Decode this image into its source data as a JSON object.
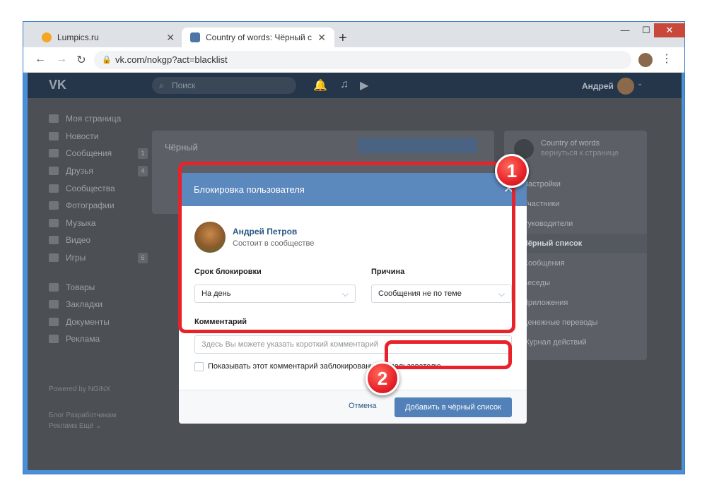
{
  "browser": {
    "tabs": [
      {
        "title": "Lumpics.ru",
        "favicon_color": "#f5a623"
      },
      {
        "title": "Country of words: Чёрный список",
        "favicon_color": "#4a76a8"
      }
    ],
    "address": "vk.com/nokgp?act=blacklist"
  },
  "vk": {
    "logo": "VK",
    "search_placeholder": "Поиск",
    "user_name": "Андрей",
    "left_menu": [
      {
        "label": "Моя страница",
        "icon": "home-icon",
        "badge": ""
      },
      {
        "label": "Новости",
        "icon": "news-icon",
        "badge": ""
      },
      {
        "label": "Сообщения",
        "icon": "chat-icon",
        "badge": "1"
      },
      {
        "label": "Друзья",
        "icon": "friends-icon",
        "badge": "4"
      },
      {
        "label": "Сообщества",
        "icon": "groups-icon",
        "badge": ""
      },
      {
        "label": "Фотографии",
        "icon": "camera-icon",
        "badge": ""
      },
      {
        "label": "Музыка",
        "icon": "music-icon",
        "badge": ""
      },
      {
        "label": "Видео",
        "icon": "video-icon",
        "badge": ""
      },
      {
        "label": "Игры",
        "icon": "gamepad-icon",
        "badge": "6"
      }
    ],
    "left_menu_2": [
      {
        "label": "Товары",
        "icon": "bag-icon"
      },
      {
        "label": "Закладки",
        "icon": "star-icon"
      },
      {
        "label": "Документы",
        "icon": "document-icon"
      },
      {
        "label": "Реклама",
        "icon": "megaphone-icon"
      }
    ],
    "footer": {
      "powered": "Powered by NGINX",
      "links_row1": "Блог   Разработчикам",
      "links_row2": "Реклама   Ещё ⌄"
    },
    "bg_card_title": "Чёрный",
    "right_col": {
      "community": "Country of words",
      "back": "вернуться к странице",
      "items": [
        {
          "label": "Настройки",
          "selected": false
        },
        {
          "label": "Участники",
          "selected": false
        },
        {
          "label": "Руководители",
          "selected": false
        },
        {
          "label": "Чёрный список",
          "selected": true
        },
        {
          "label": "Сообщения",
          "selected": false
        },
        {
          "label": "Беседы",
          "selected": false
        },
        {
          "label": "Приложения",
          "selected": false
        },
        {
          "label": "Денежные переводы",
          "selected": false
        },
        {
          "label": "Журнал действий",
          "selected": false
        }
      ]
    }
  },
  "modal": {
    "title": "Блокировка пользователя",
    "user_name": "Андрей Петров",
    "user_status": "Состоит в сообществе",
    "duration_label": "Срок блокировки",
    "duration_value": "На день",
    "reason_label": "Причина",
    "reason_value": "Сообщения не по теме",
    "comment_label": "Комментарий",
    "comment_placeholder": "Здесь Вы можете указать короткий комментарий",
    "show_comment_label": "Показывать этот комментарий заблокированному пользователю",
    "cancel_label": "Отмена",
    "submit_label": "Добавить в чёрный список"
  },
  "annotations": {
    "marker1": "1",
    "marker2": "2"
  }
}
